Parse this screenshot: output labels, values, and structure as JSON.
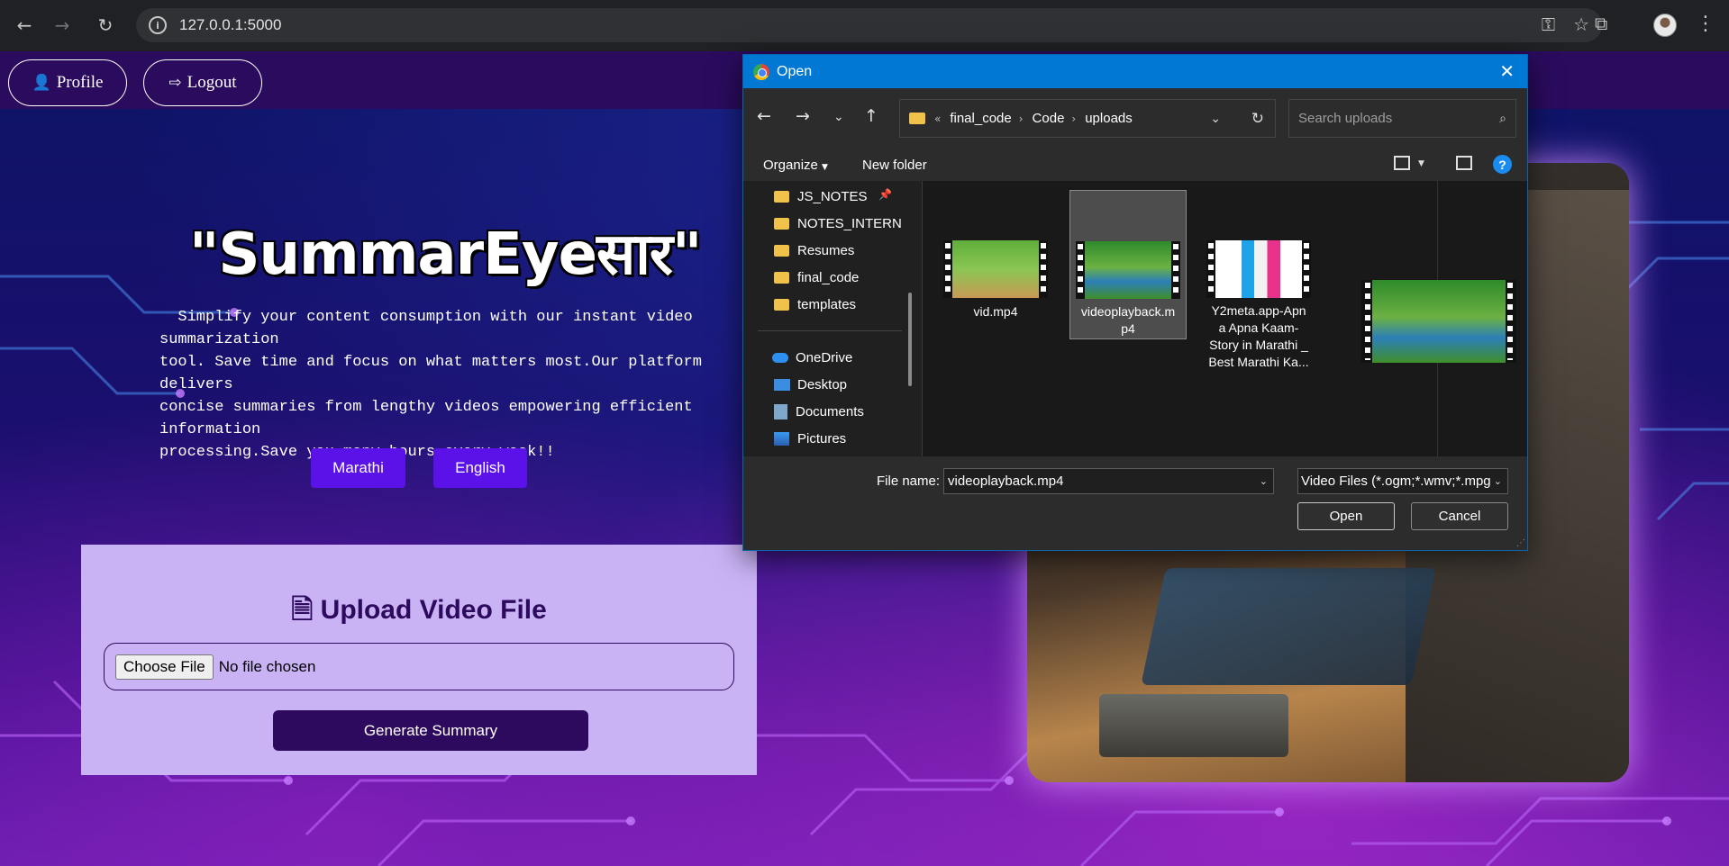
{
  "browser": {
    "back_icon": "arrow-left",
    "forward_icon": "arrow-right",
    "reload_icon": "reload",
    "url": "127.0.0.1:5000"
  },
  "header": {
    "profile_label": "Profile",
    "logout_label": "Logout"
  },
  "hero": {
    "title": "\"SummarEyeसार\"",
    "intro": "  Simplify your content consumption with our instant video summarization\ntool. Save time and focus on what matters most.Our platform delivers\nconcise summaries from lengthy videos empowering efficient information\nprocessing.Save you many hours every week!!"
  },
  "languages": [
    "Marathi",
    "English"
  ],
  "upload": {
    "title": "Upload Video File",
    "choose_label": "Choose File",
    "no_file_text": "No file chosen",
    "generate_label": "Generate Summary"
  },
  "dialog": {
    "title": "Open",
    "breadcrumb": [
      "final_code",
      "Code",
      "uploads"
    ],
    "search_placeholder": "Search uploads",
    "organize_label": "Organize",
    "new_folder_label": "New folder",
    "quick_access": [
      "JS_NOTES",
      "NOTES_INTERN",
      "Resumes",
      "final_code",
      "templates"
    ],
    "locations": [
      "OneDrive",
      "Desktop",
      "Documents",
      "Pictures"
    ],
    "files": [
      {
        "name": "vid.mp4"
      },
      {
        "name": "videoplayback.m\np4",
        "selected": true
      },
      {
        "name": "Y2meta.app-Apn\na Apna Kaam-\nStory in Marathi _\nBest Marathi Ka..."
      }
    ],
    "file_name_label": "File name:",
    "file_name_value": "videoplayback.mp4",
    "file_type_value": "Video Files (*.ogm;*.wmv;*.mpg",
    "open_label": "Open",
    "cancel_label": "Cancel"
  },
  "colors": {
    "accent": "#5b12e8",
    "dialog_title": "#0078d4",
    "upload_card": "#c9b3f5",
    "generate_button": "#2e0a5e"
  }
}
